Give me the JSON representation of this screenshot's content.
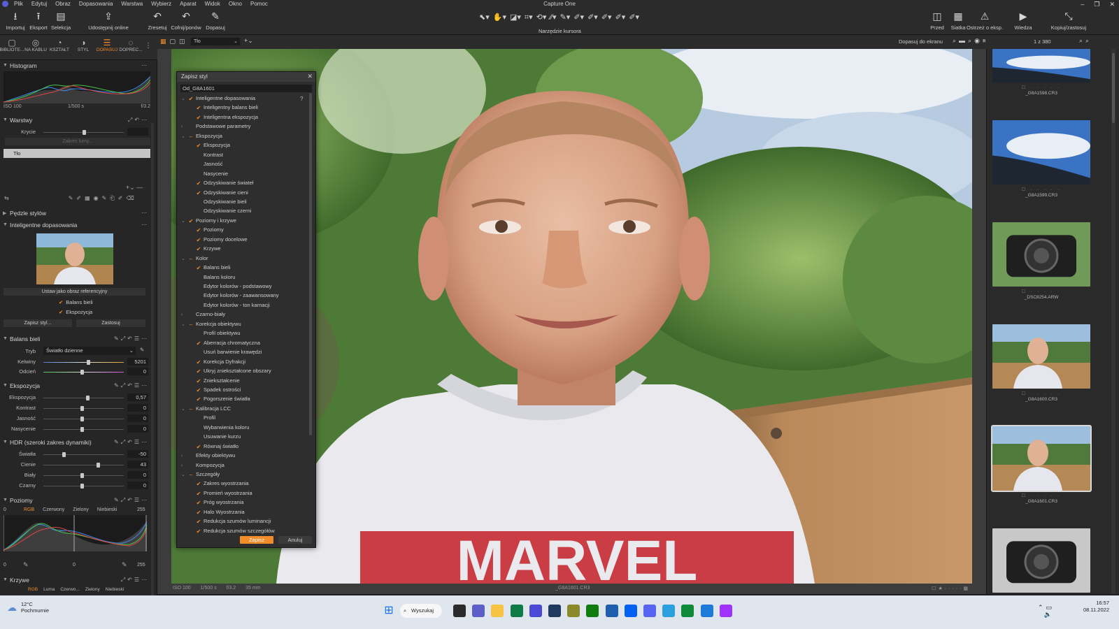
{
  "menu": [
    "Plik",
    "Edytuj",
    "Obraz",
    "Dopasowania",
    "Warstwa",
    "Wybierz",
    "Aparat",
    "Widok",
    "Okno",
    "Pomoc"
  ],
  "app_title": "Capture One",
  "window_controls": [
    "–",
    "❐",
    "✕"
  ],
  "toolbar": {
    "left": [
      {
        "icon": "⭳",
        "label": "Importuj"
      },
      {
        "icon": "⭱",
        "label": "Eksport"
      },
      {
        "icon": "▤",
        "label": "Selekcja"
      },
      {
        "icon": "⇪",
        "label": "Udostępnij online"
      },
      {
        "icon": "↶",
        "label": "Zresetuj"
      },
      {
        "icon": "↶",
        "label": "Cofnij/ponów"
      },
      {
        "icon": "✎",
        "label": "Dopasuj"
      }
    ],
    "cursor_icons": [
      "⬉▾",
      "✋▾",
      "◪▾",
      "⌗▾",
      "⟲▾",
      "∕∕▾",
      "✎▾",
      "✐▾",
      "✐▾",
      "✐▾",
      "✐▾",
      "✐▾"
    ],
    "cursor_label": "Narzędzie kursora",
    "right": [
      {
        "icon": "◫",
        "label": "Przed"
      },
      {
        "icon": "▦",
        "label": "Siatka"
      },
      {
        "icon": "⚠",
        "label": "Ostrzeż o eksp."
      },
      {
        "icon": "▶",
        "label": "Wiedza"
      },
      {
        "icon": "⤡",
        "label": "Kopiuj/zastosuj"
      }
    ]
  },
  "tool_tabs": [
    {
      "icon": "▢",
      "label": "BIBLIOTE..."
    },
    {
      "icon": "◎",
      "label": "NA KABLU"
    },
    {
      "icon": "◔",
      "label": "KSZTAŁT"
    },
    {
      "icon": "◑",
      "label": "STYL"
    },
    {
      "icon": "☰",
      "label": "DOPASUJ"
    },
    {
      "icon": "◌",
      "label": "DOPREC..."
    }
  ],
  "histogram": {
    "title": "Histogram",
    "iso": "ISO 100",
    "shutter": "1/500 s",
    "aperture": "f/3.2"
  },
  "layers": {
    "title": "Warstwy",
    "opacity_label": "Krycie",
    "range_btn": "Zakres lumy...",
    "layer_name": "Tło"
  },
  "style_brushes": {
    "title": "Pędzle stylów"
  },
  "smart_adjust": {
    "title": "Inteligentne dopasowania",
    "ref_btn": "Ustaw jako obraz referencyjny",
    "checks": [
      "Balans bieli",
      "Ekspozycja"
    ],
    "save_btn": "Zapisz styl...",
    "apply_btn": "Zastosuj"
  },
  "white_balance": {
    "title": "Balans bieli",
    "mode_label": "Tryb",
    "mode_value": "Światło dzienne",
    "rows": [
      {
        "name": "Kelwiny",
        "value": "5201",
        "pos": 0.56
      },
      {
        "name": "Odcień",
        "value": "0",
        "pos": 0.48
      }
    ]
  },
  "exposure": {
    "title": "Ekspozycja",
    "rows": [
      {
        "name": "Ekspozycja",
        "value": "0,57",
        "pos": 0.55
      },
      {
        "name": "Kontrast",
        "value": "0",
        "pos": 0.48
      },
      {
        "name": "Jasność",
        "value": "0",
        "pos": 0.48
      },
      {
        "name": "Nasycenie",
        "value": "0",
        "pos": 0.48
      }
    ]
  },
  "hdr": {
    "title": "HDR (szeroki zakres dynamiki)",
    "rows": [
      {
        "name": "Światła",
        "value": "-50",
        "pos": 0.25
      },
      {
        "name": "Cienie",
        "value": "43",
        "pos": 0.68
      },
      {
        "name": "Biały",
        "value": "0",
        "pos": 0.48
      },
      {
        "name": "Czarny",
        "value": "0",
        "pos": 0.48
      }
    ]
  },
  "levels": {
    "title": "Poziomy",
    "left": "0",
    "right": "255",
    "tabs": [
      "RGB",
      "Czerwony",
      "Zielony",
      "Niebieski"
    ],
    "bottom_left": "0",
    "bottom_mid": "0",
    "bottom_right": "255"
  },
  "curves": {
    "title": "Krzywe",
    "tabs": [
      "RGB",
      "Luma",
      "Czerwo...",
      "Zielony",
      "Niebieski"
    ]
  },
  "viewbar": {
    "layer_select": "Tło",
    "fit": "Dopasuj do ekranu",
    "counter": "1 z 380"
  },
  "photo_meta": {
    "iso": "ISO 100",
    "shutter": "1/500 s",
    "aperture": "f/3.2",
    "focal": "35 mm",
    "filename": "_G8A1601.CR3"
  },
  "shirt_text": "MARVEL",
  "dialog": {
    "title": "Zapisz styl",
    "name": "Od_G8A1601",
    "help": "?",
    "items": [
      {
        "t": "Inteligentne dopasowania",
        "lvl": 0,
        "exp": "open",
        "chk": "on"
      },
      {
        "t": "Inteligentny balans bieli",
        "lvl": 1,
        "chk": "on"
      },
      {
        "t": "Inteligentna ekspozycja",
        "lvl": 1,
        "chk": "on"
      },
      {
        "t": "Podstawowe parametry",
        "lvl": 0,
        "exp": "closed",
        "chk": "off"
      },
      {
        "t": "Ekspozycja",
        "lvl": 0,
        "exp": "open",
        "chk": "part"
      },
      {
        "t": "Ekspozycja",
        "lvl": 1,
        "chk": "on"
      },
      {
        "t": "Kontrast",
        "lvl": 1,
        "chk": "off"
      },
      {
        "t": "Jasność",
        "lvl": 1,
        "chk": "off"
      },
      {
        "t": "Nasycenie",
        "lvl": 1,
        "chk": "off"
      },
      {
        "t": "Odzyskiwanie świateł",
        "lvl": 1,
        "chk": "on"
      },
      {
        "t": "Odzyskiwanie cieni",
        "lvl": 1,
        "chk": "on"
      },
      {
        "t": "Odzyskiwanie bieli",
        "lvl": 1,
        "chk": "off"
      },
      {
        "t": "Odzyskiwanie czerni",
        "lvl": 1,
        "chk": "off"
      },
      {
        "t": "Poziomy i krzywe",
        "lvl": 0,
        "exp": "open",
        "chk": "on"
      },
      {
        "t": "Poziomy",
        "lvl": 1,
        "chk": "on"
      },
      {
        "t": "Poziomy docelowe",
        "lvl": 1,
        "chk": "on"
      },
      {
        "t": "Krzywe",
        "lvl": 1,
        "chk": "on"
      },
      {
        "t": "Kolor",
        "lvl": 0,
        "exp": "open",
        "chk": "part"
      },
      {
        "t": "Balans bieli",
        "lvl": 1,
        "chk": "on"
      },
      {
        "t": "Balans koloru",
        "lvl": 1,
        "chk": "off"
      },
      {
        "t": "Edytor kolorów - podstawowy",
        "lvl": 1,
        "chk": "off"
      },
      {
        "t": "Edytor kolorów - zaawansowany",
        "lvl": 1,
        "chk": "off"
      },
      {
        "t": "Edytor kolorów - ton karnacji",
        "lvl": 1,
        "chk": "off"
      },
      {
        "t": "Czarno-biały",
        "lvl": 0,
        "exp": "closed",
        "chk": "off"
      },
      {
        "t": "Korekcja obiektywu",
        "lvl": 0,
        "exp": "open",
        "chk": "part"
      },
      {
        "t": "Profil obiektywu",
        "lvl": 1,
        "chk": "off"
      },
      {
        "t": "Aberracja chromatyczna",
        "lvl": 1,
        "chk": "on"
      },
      {
        "t": "Usuń barwienie krawędzi",
        "lvl": 1,
        "chk": "off"
      },
      {
        "t": "Korekcja Dyfrakcji",
        "lvl": 1,
        "chk": "on"
      },
      {
        "t": "Ukryj zniekształcone obszary",
        "lvl": 1,
        "chk": "on"
      },
      {
        "t": "Zniekształcenie",
        "lvl": 1,
        "chk": "on"
      },
      {
        "t": "Spadek ostrości",
        "lvl": 1,
        "chk": "on"
      },
      {
        "t": "Pogorszenie światła",
        "lvl": 1,
        "chk": "on"
      },
      {
        "t": "Kalibracja LCC",
        "lvl": 0,
        "exp": "open",
        "chk": "part"
      },
      {
        "t": "Profil",
        "lvl": 1,
        "chk": "off"
      },
      {
        "t": "Wybarwienia koloru",
        "lvl": 1,
        "chk": "off"
      },
      {
        "t": "Usuwanie kurzu",
        "lvl": 1,
        "chk": "off"
      },
      {
        "t": "Równaj światło",
        "lvl": 1,
        "chk": "on"
      },
      {
        "t": "Efekty obiektywu",
        "lvl": 0,
        "exp": "closed",
        "chk": "off"
      },
      {
        "t": "Kompozycja",
        "lvl": 0,
        "exp": "closed",
        "chk": "off"
      },
      {
        "t": "Szczegóły",
        "lvl": 0,
        "exp": "open",
        "chk": "part"
      },
      {
        "t": "Zakres wyostrzania",
        "lvl": 1,
        "chk": "on"
      },
      {
        "t": "Promień wyostrzania",
        "lvl": 1,
        "chk": "on"
      },
      {
        "t": "Próg wyostrzania",
        "lvl": 1,
        "chk": "on"
      },
      {
        "t": "Halo Wyostrzania",
        "lvl": 1,
        "chk": "on"
      },
      {
        "t": "Redukcja szumów luminancji",
        "lvl": 1,
        "chk": "on"
      },
      {
        "t": "Redukcja szumów szczegółów",
        "lvl": 1,
        "chk": "on"
      }
    ],
    "save": "Zapisz",
    "cancel": "Anuluj"
  },
  "filmstrip": [
    {
      "name": "_G8A1598.CR3",
      "kind": "sky"
    },
    {
      "name": "_G8A1599.CR3",
      "kind": "sky"
    },
    {
      "name": "_DSC8254.ARW",
      "kind": "camera"
    },
    {
      "name": "_G8A1600.CR3",
      "kind": "portrait"
    },
    {
      "name": "_G8A1601.CR3",
      "kind": "portrait",
      "selected": true
    },
    {
      "name": "",
      "kind": "camera2"
    }
  ],
  "taskbar": {
    "temp": "12°C",
    "weather": "Pochmurnie",
    "search": "Wyszukaj",
    "time": "16:57",
    "date": "08.11.2022"
  },
  "colors": {
    "accent": "#f08c2a",
    "panel": "#262626",
    "toolbar": "#2b2b2b"
  }
}
